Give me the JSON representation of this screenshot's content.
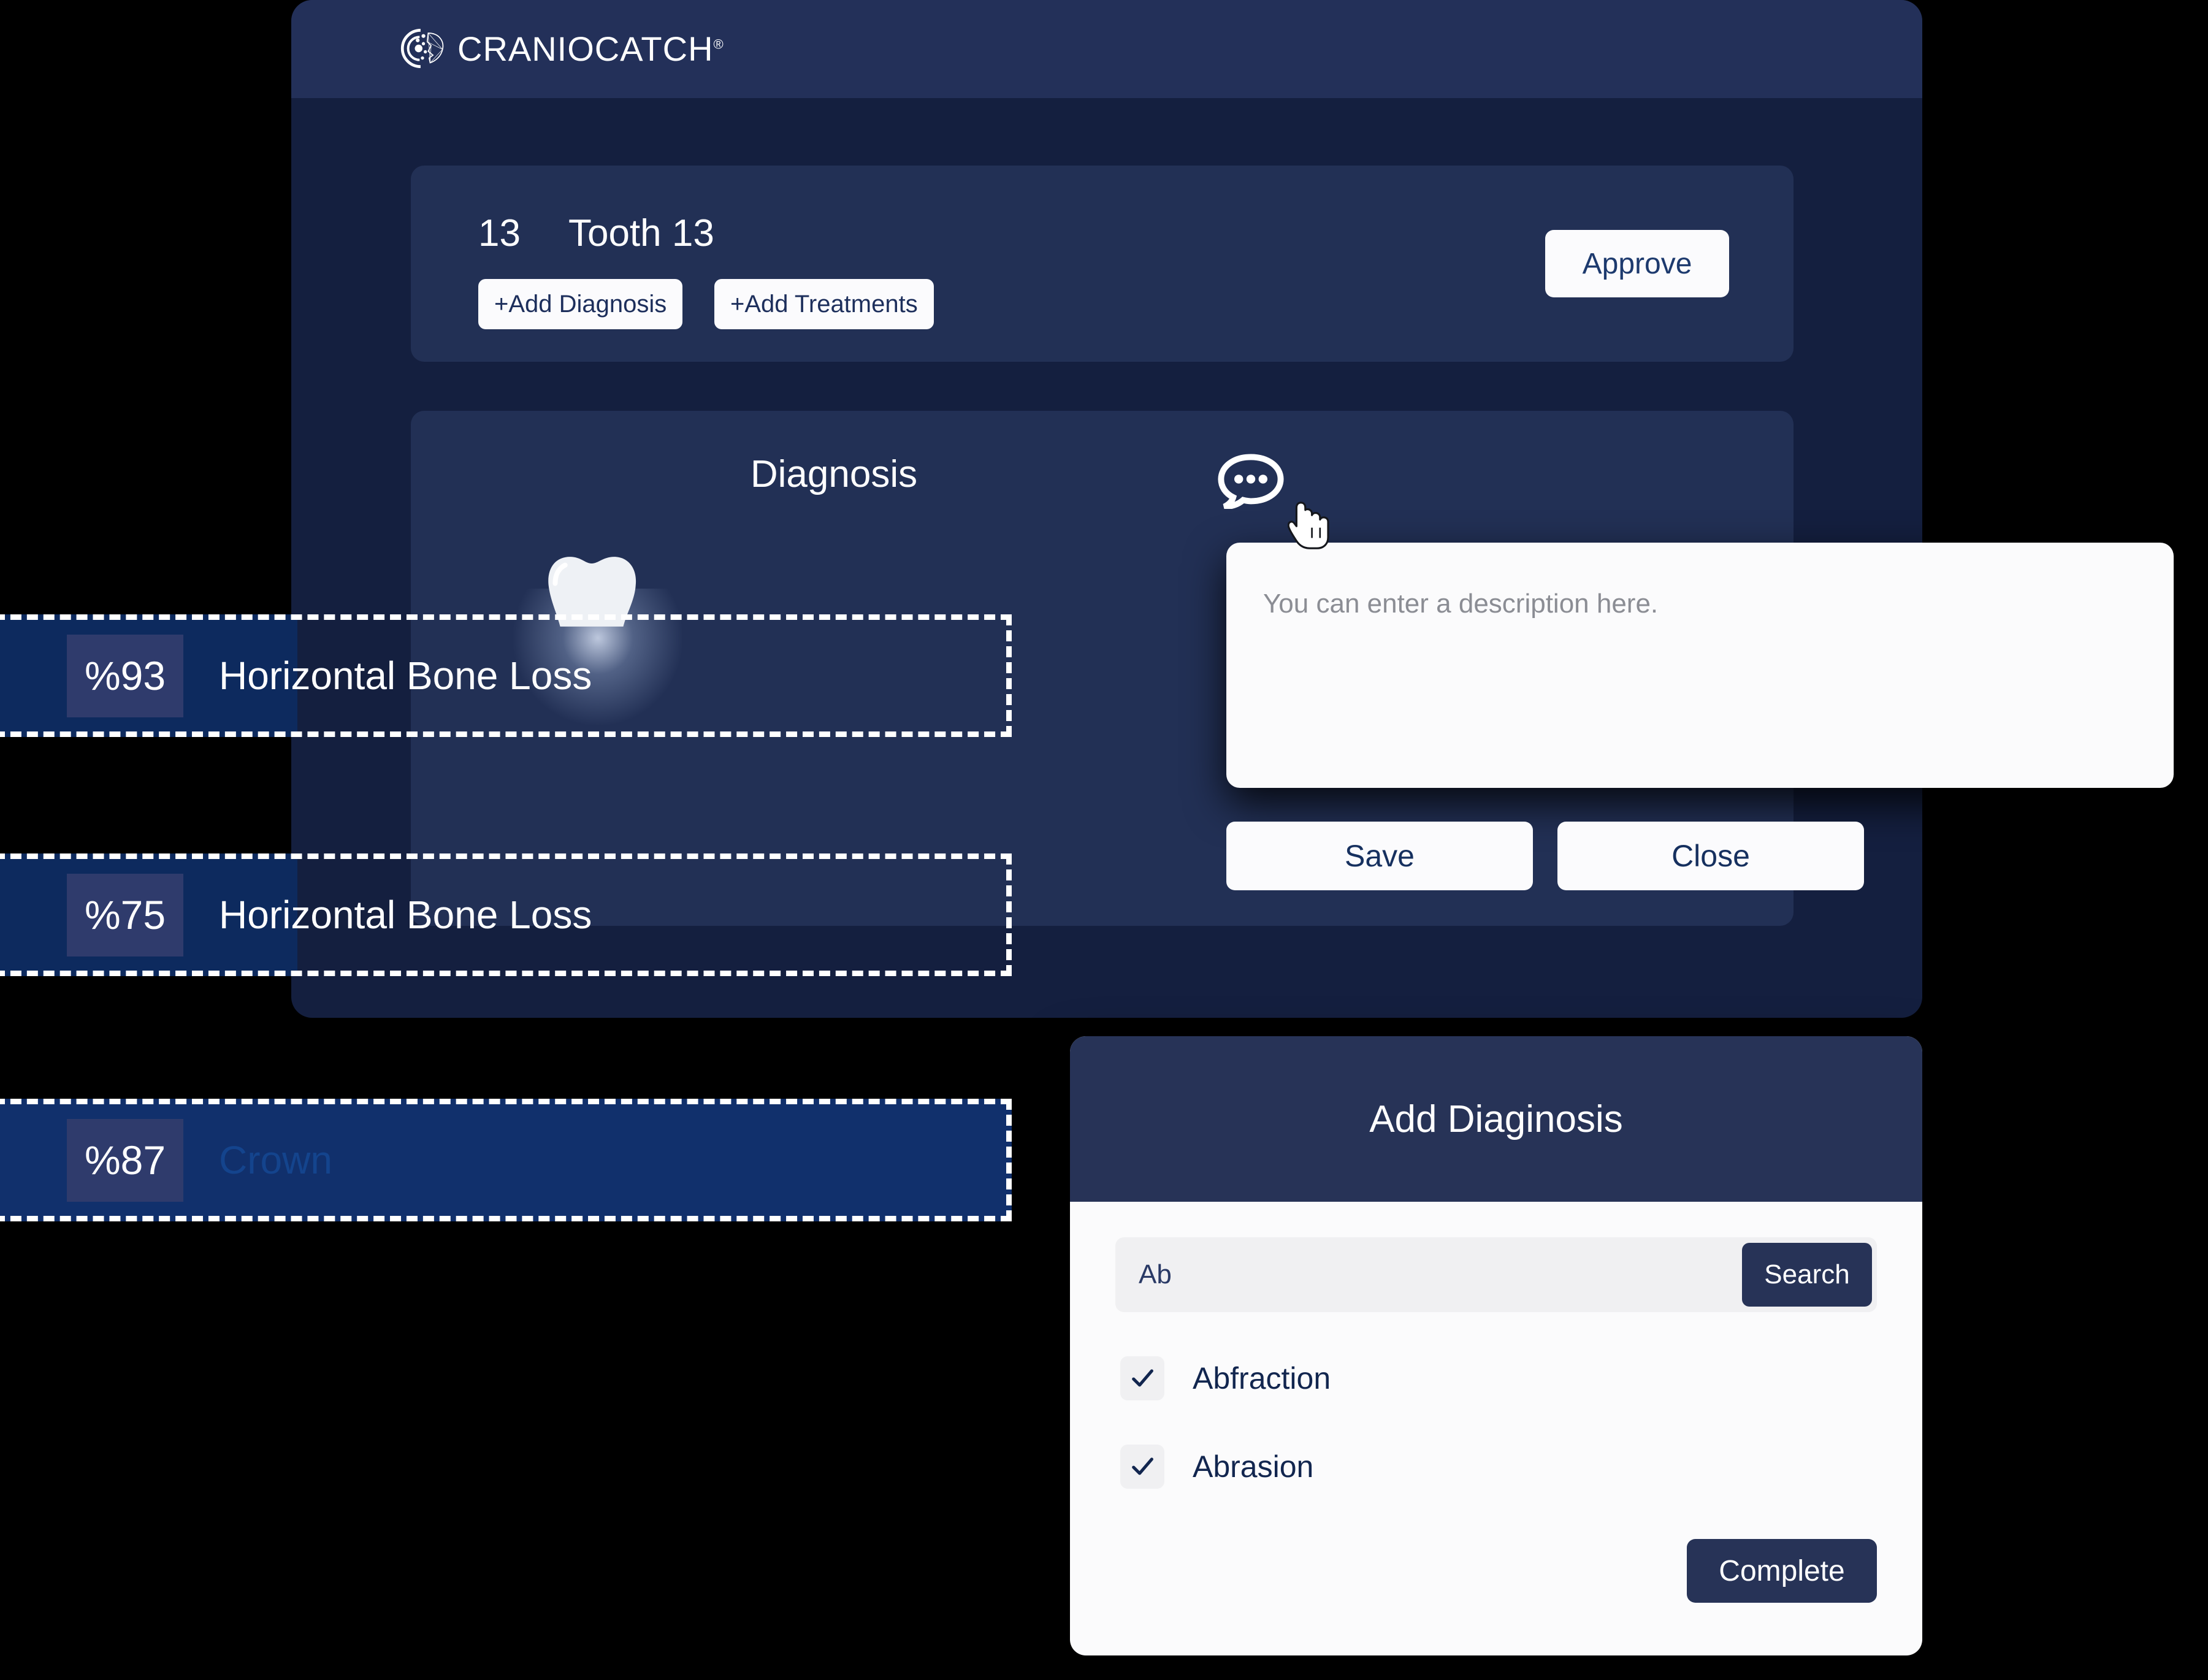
{
  "brand": {
    "name": "CRANIOCATCH",
    "registered_mark": "®",
    "logo_icon": "craniocatch-brain-logo-icon"
  },
  "tooth_card": {
    "number": "13",
    "name": "Tooth 13",
    "add_diagnosis_label": "+Add Diagnosis",
    "add_treatments_label": "+Add Treatments",
    "approve_label": "Approve"
  },
  "diagnosis_panel": {
    "title": "Diagnosis",
    "tooth_icon": "tooth-icon",
    "comment_icon": "comment-bubble-icon",
    "cursor_icon": "pointing-hand-cursor-icon",
    "results": [
      {
        "percent": "%93",
        "label": "Horizontal Bone Loss",
        "selected": false
      },
      {
        "percent": "%75",
        "label": "Horizontal Bone Loss",
        "selected": false
      },
      {
        "percent": "%87",
        "label": "Crown",
        "selected": true
      }
    ]
  },
  "description_popup": {
    "placeholder": "You can enter a description here.",
    "value": "",
    "save_label": "Save",
    "close_label": "Close"
  },
  "add_diagnosis_modal": {
    "title": "Add Diaginosis",
    "search_value": "Ab",
    "search_placeholder": "",
    "search_button_label": "Search",
    "check_icon": "check-icon",
    "options": [
      {
        "label": "Abfraction",
        "checked": true
      },
      {
        "label": "Abrasion",
        "checked": true
      }
    ],
    "complete_label": "Complete"
  },
  "colors": {
    "page_background": "#000000",
    "window_body": "#141f3f",
    "window_header": "#233059",
    "card": "#223055",
    "accent_navy": "#273357",
    "badge": "#2f3b6c",
    "selected_row": "#11306c",
    "muted_label": "#14448d",
    "surface_white": "#fbfbfc"
  }
}
